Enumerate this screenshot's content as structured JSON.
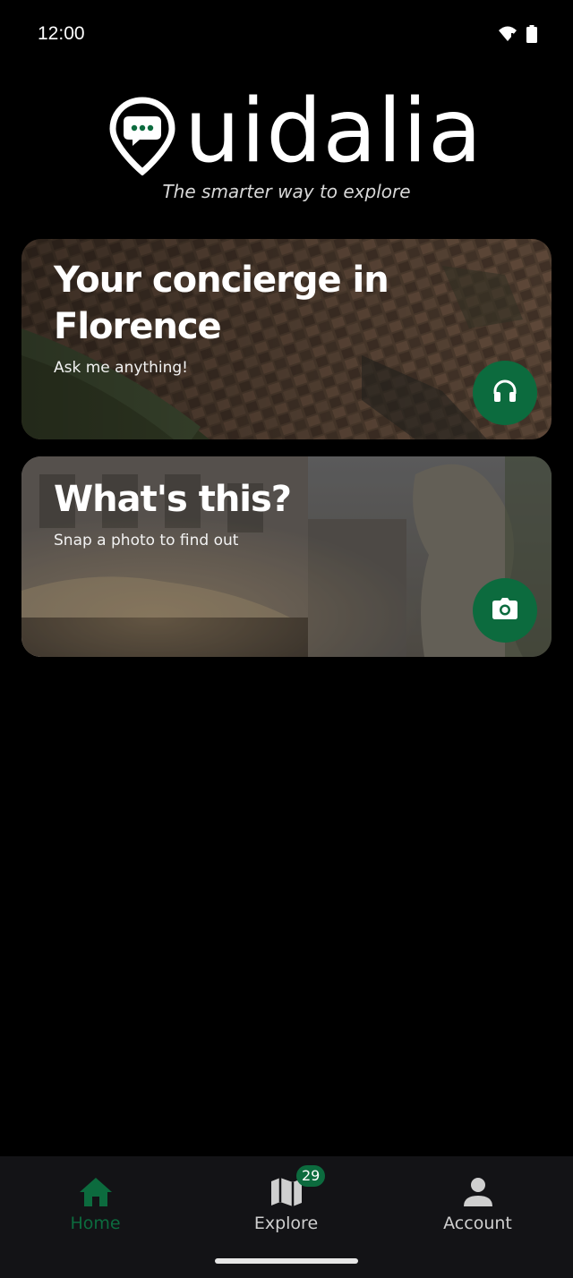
{
  "status_bar": {
    "time": "12:00",
    "icons": [
      "wifi-icon",
      "battery-icon"
    ]
  },
  "brand": {
    "wordmark": "uidalia",
    "tagline": "The smarter way to explore"
  },
  "cards": [
    {
      "title": "Your concierge in Florence",
      "subtitle": "Ask me anything!",
      "action_icon": "headphones-icon"
    },
    {
      "title": "What's this?",
      "subtitle": "Snap a photo to find out",
      "action_icon": "camera-icon"
    }
  ],
  "nav": {
    "items": [
      {
        "label": "Home",
        "icon": "home-icon",
        "active": true
      },
      {
        "label": "Explore",
        "icon": "map-icon",
        "badge": "29"
      },
      {
        "label": "Account",
        "icon": "person-icon"
      }
    ]
  },
  "colors": {
    "accent": "#0c6b3e",
    "background": "#000000",
    "nav_background": "#131316"
  }
}
